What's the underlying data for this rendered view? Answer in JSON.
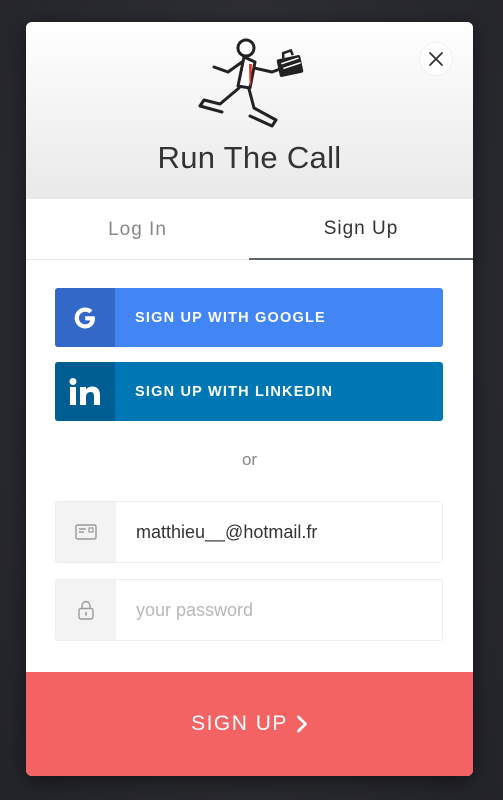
{
  "modal": {
    "title": "Run The Call",
    "close_icon": "close-icon",
    "logo_icon": "running-businessman-icon"
  },
  "tabs": [
    {
      "label": "Log In",
      "active": false
    },
    {
      "label": "Sign Up",
      "active": true
    }
  ],
  "social": {
    "google_label": "SIGN UP WITH GOOGLE",
    "google_icon": "google-icon",
    "linkedin_label": "SIGN UP WITH LINKEDIN",
    "linkedin_icon": "linkedin-icon"
  },
  "divider_text": "or",
  "form": {
    "email_value": "matthieu__@hotmail.fr",
    "email_icon": "email-card-icon",
    "password_placeholder": "your password",
    "password_icon": "lock-icon",
    "submit_label": "SIGN UP",
    "submit_icon": "chevron-right-icon"
  },
  "colors": {
    "google": "#4285f4",
    "linkedin": "#0077b5",
    "submit": "#f46363"
  }
}
